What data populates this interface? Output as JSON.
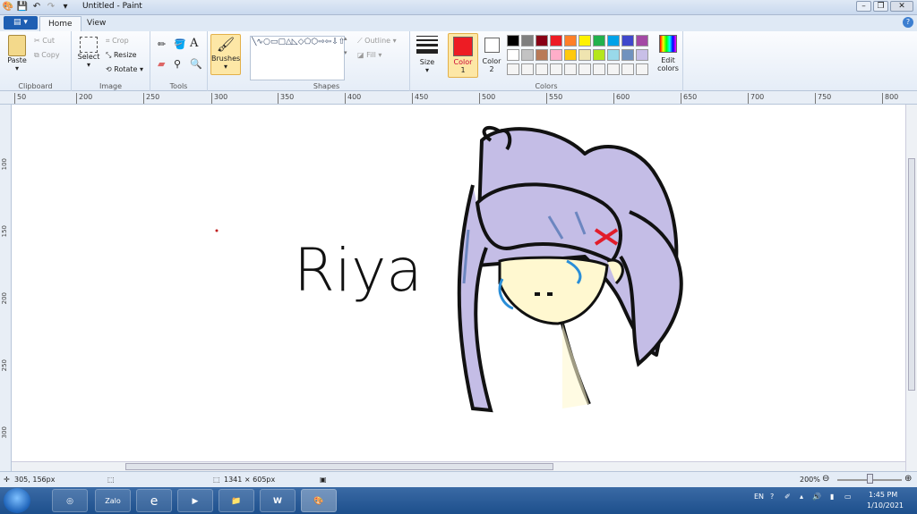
{
  "window": {
    "title": "Untitled - Paint"
  },
  "tabs": {
    "file": "▤ ▾",
    "home": "Home",
    "view": "View"
  },
  "clipboard": {
    "paste": "Paste",
    "cut": "Cut",
    "copy": "Copy",
    "label": "Clipboard"
  },
  "image": {
    "select": "Select",
    "crop": "Crop",
    "resize": "Resize",
    "rotate": "Rotate",
    "label": "Image"
  },
  "tools": {
    "label": "Tools"
  },
  "brushes": {
    "label": "Brushes"
  },
  "shapes": {
    "outline": "Outline",
    "fill": "Fill",
    "label": "Shapes",
    "glyphs": "╲∿○▭▢△◺◇⬠⬡⇨⇦⇩⇧✦☆✡▭◯▭ "
  },
  "size": {
    "label": "Size"
  },
  "colors": {
    "color1": "Color",
    "color1_num": "1",
    "color2": "Color",
    "color2_num": "2",
    "edit": "Edit",
    "edit2": "colors",
    "label": "Colors",
    "color1_value": "#ed1c24",
    "color2_value": "#ffffff",
    "palette": [
      "#000000",
      "#7f7f7f",
      "#880015",
      "#ed1c24",
      "#ff7f27",
      "#fff200",
      "#22b14c",
      "#00a2e8",
      "#3f48cc",
      "#a349a4",
      "#ffffff",
      "#c3c3c3",
      "#b97a57",
      "#ffaec9",
      "#ffc90e",
      "#efe4b0",
      "#b5e61d",
      "#99d9ea",
      "#7092be",
      "#c8bfe7"
    ]
  },
  "ruler": {
    "h": [
      "50",
      "200",
      "250",
      "300",
      "350",
      "400",
      "450",
      "500",
      "550",
      "600",
      "650",
      "700",
      "750",
      "800"
    ],
    "v": [
      "100",
      "150",
      "200",
      "250",
      "300"
    ]
  },
  "drawing": {
    "text": "Riya"
  },
  "status": {
    "cursor": "305, 156px",
    "size": "1341 × 605px",
    "zoom": "200%"
  },
  "taskbar": {
    "zalo": "Zalo",
    "lang": "EN",
    "time": "1:45 PM",
    "date": "1/10/2021"
  }
}
